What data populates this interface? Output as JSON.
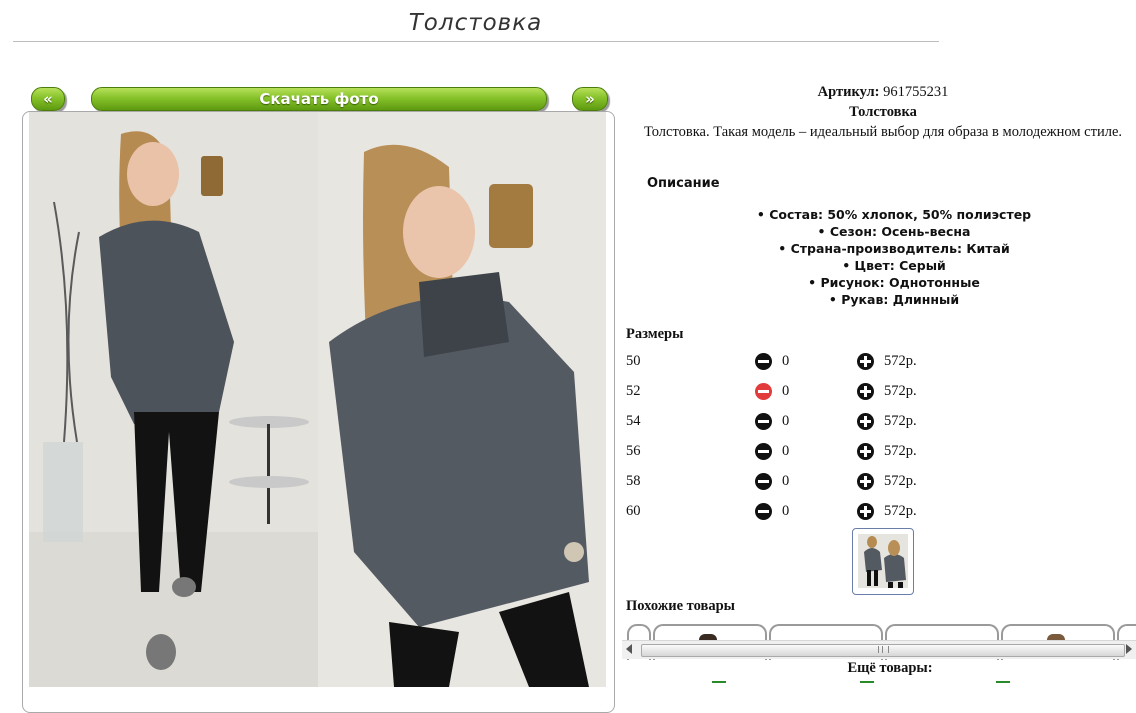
{
  "page": {
    "title": "Толстовка"
  },
  "gallery": {
    "prev_label": "«",
    "download_label": "Скачать фото",
    "next_label": "»"
  },
  "product": {
    "article_label": "Артикул:",
    "article_value": "961755231",
    "name": "Толстовка",
    "summary": "Толстовка. Такая модель – идеальный выбор для образа в молодежном стиле.",
    "description_title": "Описание",
    "properties": [
      "Состав: 50% хлопок, 50% полиэстер",
      "Сезон: Осень-весна",
      "Страна-производитель: Китай",
      "Цвет: Серый",
      "Рисунок: Однотонные",
      "Рукав: Длинный"
    ]
  },
  "sizes": {
    "title": "Размеры",
    "rows": [
      {
        "size": "50",
        "qty": "0",
        "price": "572р."
      },
      {
        "size": "52",
        "qty": "0",
        "price": "572р."
      },
      {
        "size": "54",
        "qty": "0",
        "price": "572р."
      },
      {
        "size": "56",
        "qty": "0",
        "price": "572р."
      },
      {
        "size": "58",
        "qty": "0",
        "price": "572р."
      },
      {
        "size": "60",
        "qty": "0",
        "price": "572р."
      }
    ]
  },
  "similar": {
    "title": "Похожие товары"
  },
  "more": {
    "title": "Ещё товары:"
  },
  "colors": {
    "button_green": "#7cb51f",
    "minus_active": "#e23b3b",
    "link_green": "#2a8a2a"
  }
}
